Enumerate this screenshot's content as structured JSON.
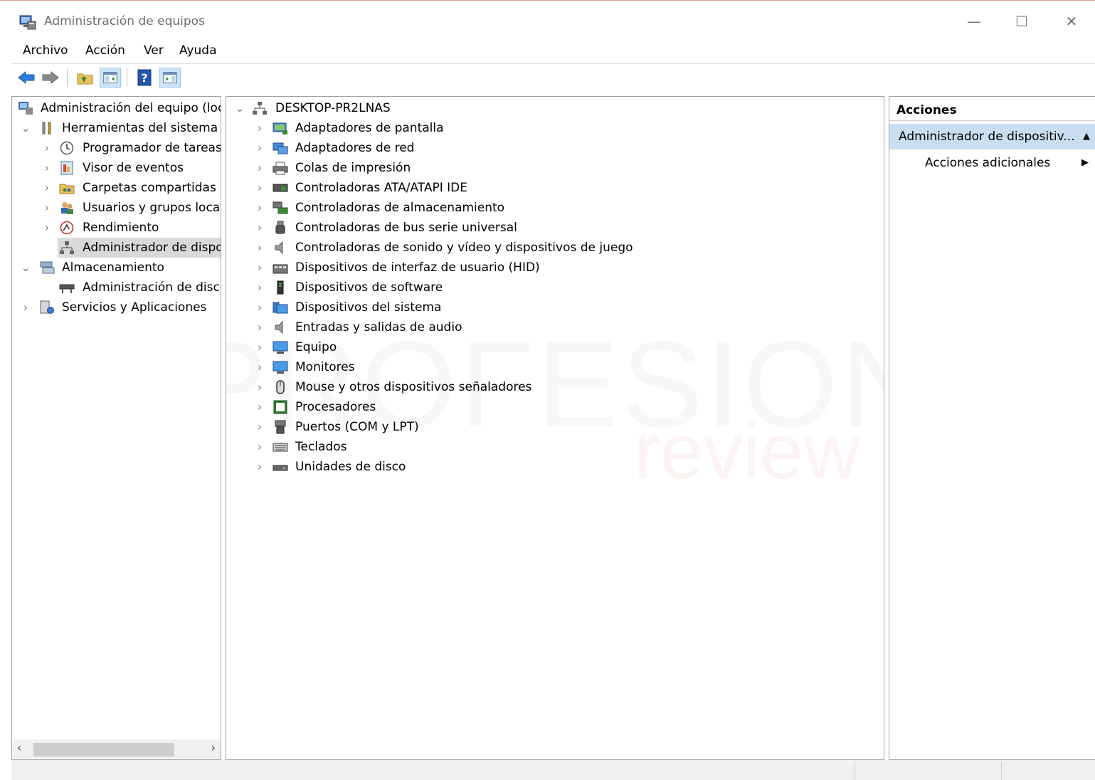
{
  "window": {
    "title": "Administración de equipos",
    "minimize": "—",
    "maximize": "☐",
    "close": "✕"
  },
  "menu": [
    "Archivo",
    "Acción",
    "Ver",
    "Ayuda"
  ],
  "toolbar": {
    "icons": [
      "back-arrow-icon",
      "forward-arrow-icon",
      "up-folder-icon",
      "show-hide-tree-icon",
      "help-icon",
      "show-hide-action-pane-icon"
    ]
  },
  "left_tree": {
    "root": "Administración del equipo (loc",
    "system_tools": "Herramientas del sistema",
    "task_scheduler": "Programador de tareas",
    "event_viewer": "Visor de eventos",
    "shared_folders": "Carpetas compartidas",
    "local_users": "Usuarios y grupos locale",
    "performance": "Rendimiento",
    "device_manager": "Administrador de dispo",
    "storage": "Almacenamiento",
    "disk_management": "Administración de disco",
    "services_apps": "Servicios y Aplicaciones"
  },
  "devices": {
    "computer": "DESKTOP-PR2LNAS",
    "items": [
      "Adaptadores de pantalla",
      "Adaptadores de red",
      "Colas de impresión",
      "Controladoras ATA/ATAPI IDE",
      "Controladoras de almacenamiento",
      "Controladoras de bus serie universal",
      "Controladoras de sonido y vídeo y dispositivos de juego",
      "Dispositivos de interfaz de usuario (HID)",
      "Dispositivos de software",
      "Dispositivos del sistema",
      "Entradas y salidas de audio",
      "Equipo",
      "Monitores",
      "Mouse y otros dispositivos señaladores",
      "Procesadores",
      "Puertos (COM y LPT)",
      "Teclados",
      "Unidades de disco"
    ]
  },
  "actions": {
    "header": "Acciones",
    "section": "Administrador de dispositiv...",
    "more": "Acciones adicionales"
  },
  "watermark": {
    "main": "PROFESIONAL",
    "sub": "review"
  }
}
